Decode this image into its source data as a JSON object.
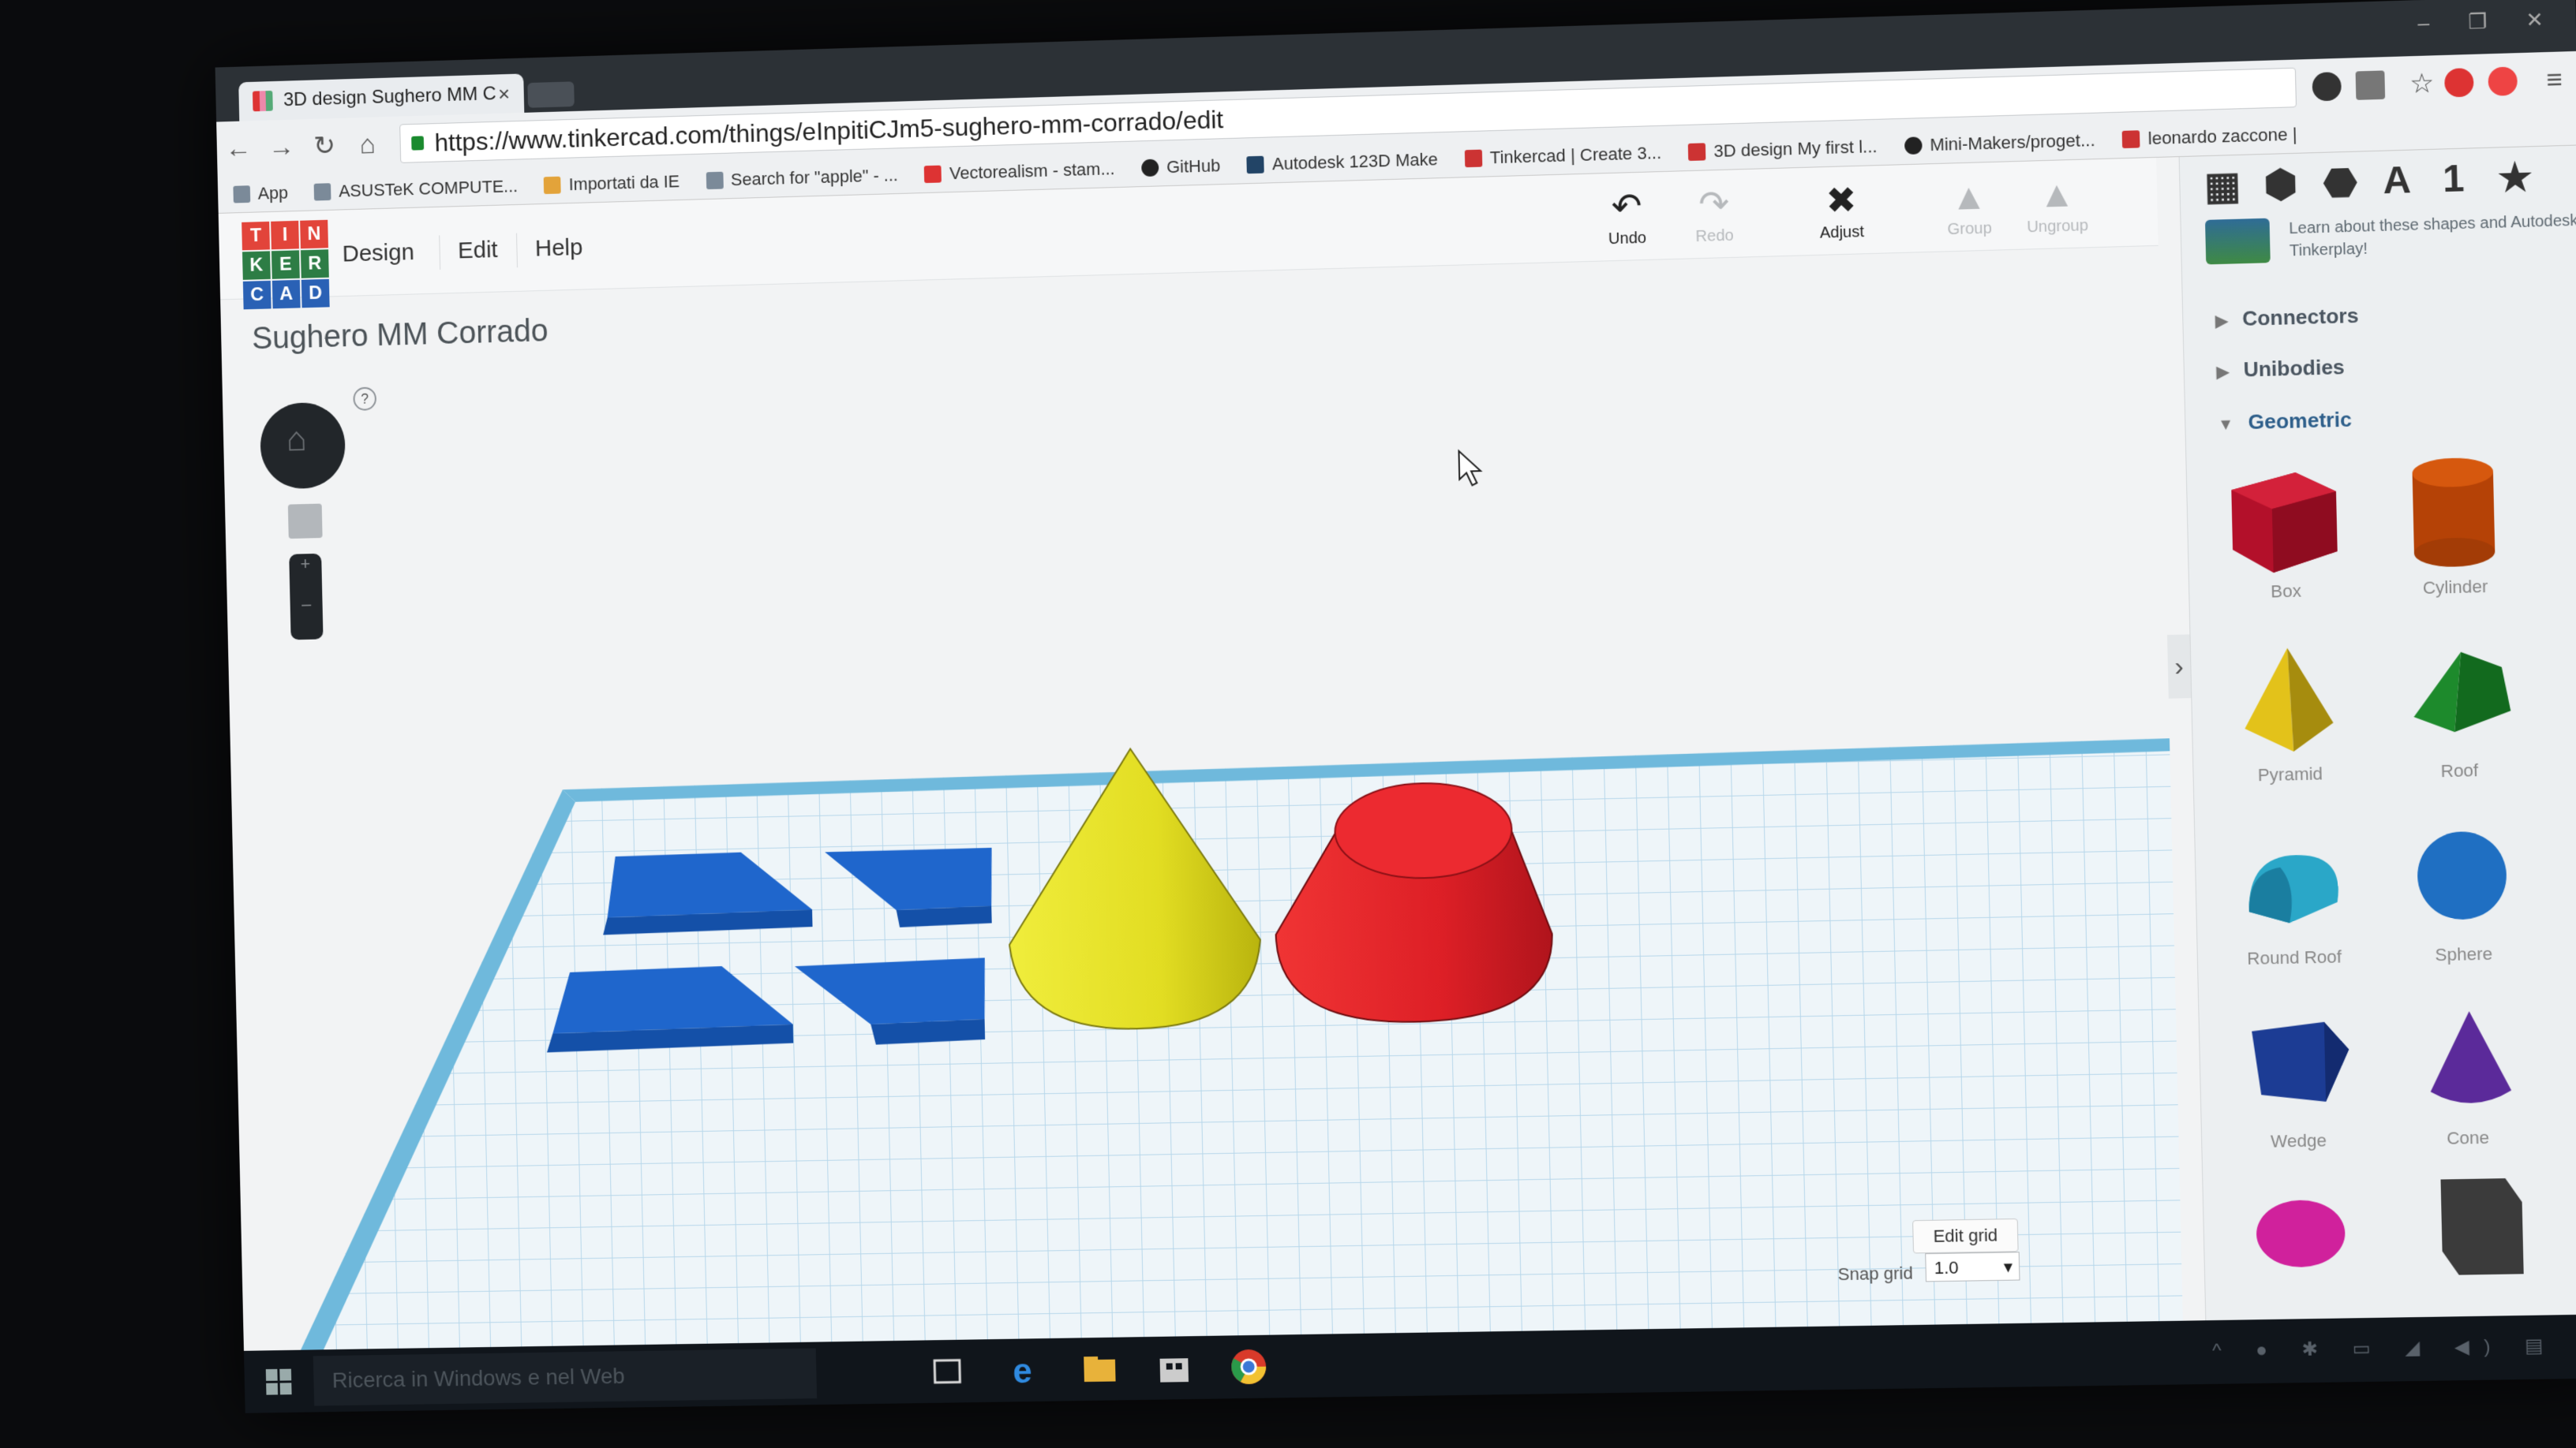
{
  "browser": {
    "tab_title": "3D design Sughero MM C",
    "tab_close": "×",
    "url": "https://www.tinkercad.com/things/eInpitiCJm5-sughero-mm-corrado/edit",
    "bookmarks": [
      {
        "label": "App"
      },
      {
        "label": "ASUSTeK COMPUTE..."
      },
      {
        "label": "Importati da IE"
      },
      {
        "label": "Search for \"apple\" - ..."
      },
      {
        "label": "Vectorealism - stam..."
      },
      {
        "label": "GitHub"
      },
      {
        "label": "Autodesk 123D Make"
      },
      {
        "label": "Tinkercad | Create 3..."
      },
      {
        "label": "3D design My first l..."
      },
      {
        "label": "Mini-Makers/proget..."
      },
      {
        "label": "leonardo zaccone |"
      }
    ]
  },
  "app": {
    "logo_letters": [
      "T",
      "I",
      "N",
      "K",
      "E",
      "R",
      "C",
      "A",
      "D"
    ],
    "menu": {
      "design": "Design",
      "edit": "Edit",
      "help": "Help"
    },
    "tools": {
      "undo": "Undo",
      "redo": "Redo",
      "adjust": "Adjust",
      "group": "Group",
      "ungroup": "Ungroup"
    },
    "design_title": "Sughero MM Corrado",
    "help_mark": "?",
    "edit_grid": "Edit grid",
    "snap_grid_label": "Snap grid",
    "snap_grid_value": "1.0"
  },
  "panel": {
    "icons": [
      "grid-icon",
      "box-view-icon",
      "cube-icon",
      "text-icon",
      "number-icon",
      "star-icon"
    ],
    "info_text": "Learn about these shapes and Autodesk Tinkerplay!",
    "sections": {
      "connectors": "Connectors",
      "unibodies": "Unibodies",
      "geometric": "Geometric"
    },
    "shapes": [
      {
        "label": "Box",
        "color": "#c4142a"
      },
      {
        "label": "Cylinder",
        "color": "#c64a0a"
      },
      {
        "label": "Pyramid",
        "color": "#e3c21a"
      },
      {
        "label": "Roof",
        "color": "#1d8a2c"
      },
      {
        "label": "Round Roof",
        "color": "#2aa7c8"
      },
      {
        "label": "Sphere",
        "color": "#1f6fc2"
      },
      {
        "label": "Wedge",
        "color": "#1c3c94"
      },
      {
        "label": "Cone",
        "color": "#5b2a9a"
      },
      {
        "label": "",
        "color": "#d0219c"
      },
      {
        "label": "",
        "color": "#3b3b3b"
      }
    ]
  },
  "scene": {
    "objects": [
      {
        "name": "Trapezoid",
        "color": "#1e6fd6"
      },
      {
        "name": "Trapezoid",
        "color": "#1e6fd6"
      },
      {
        "name": "Trapezoid",
        "color": "#1e6fd6"
      },
      {
        "name": "Trapezoid",
        "color": "#1e6fd6"
      },
      {
        "name": "Cone",
        "color": "#e3df2a"
      },
      {
        "name": "Truncated cone",
        "color": "#e0202c"
      }
    ]
  },
  "taskbar": {
    "search_placeholder": "Ricerca in Windows e nel Web"
  }
}
